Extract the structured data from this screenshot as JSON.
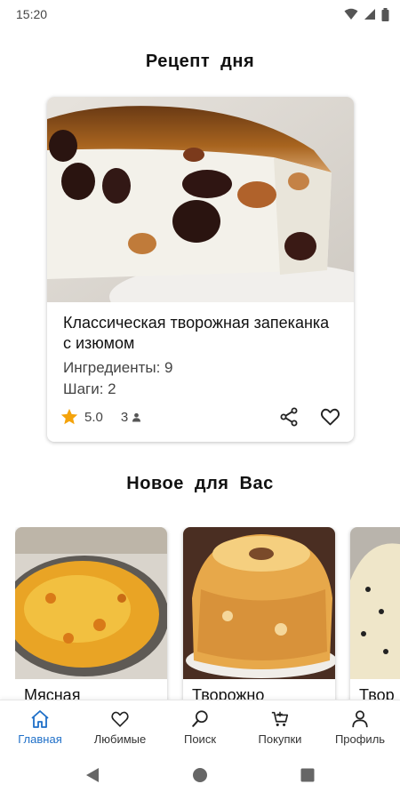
{
  "status": {
    "time": "15:20"
  },
  "recipe_of_day": {
    "heading": "Рецепт  дня",
    "title": "Классическая творожная запеканка с изюмом",
    "ingredients": "Ингредиенты: 9",
    "steps": "Шаги: 2",
    "rating": "5.0",
    "reviews": "3",
    "colors": {
      "star": "#f4a30b"
    }
  },
  "new_for_you": {
    "heading": "Новое  для  Вас",
    "cards": [
      {
        "title": "Мясная"
      },
      {
        "title": "Творожно"
      },
      {
        "title": "Твор"
      }
    ]
  },
  "bottom_nav": {
    "items": [
      {
        "label": "Главная",
        "icon": "home-icon",
        "active": true
      },
      {
        "label": "Любимые",
        "icon": "heart-icon"
      },
      {
        "label": "Поиск",
        "icon": "search-icon"
      },
      {
        "label": "Покупки",
        "icon": "cart-icon"
      },
      {
        "label": "Профиль",
        "icon": "profile-icon"
      }
    ],
    "colors": {
      "active": "#1e6fc8"
    }
  }
}
